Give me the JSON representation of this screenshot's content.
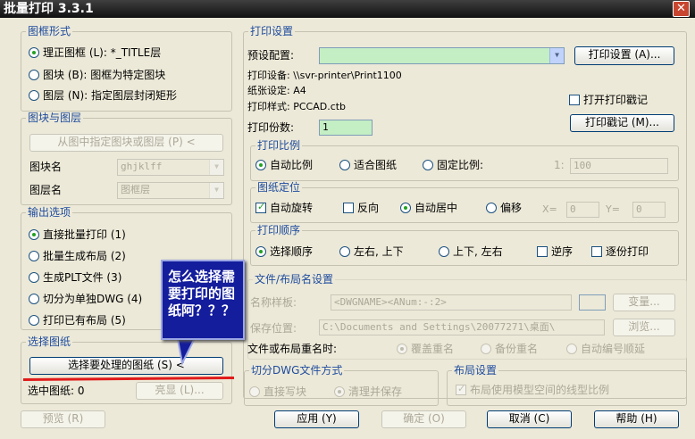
{
  "window": {
    "title": "批量打印 3.3.1",
    "close_glyph": "✕"
  },
  "frame_form": {
    "title": "图框形式",
    "options": [
      {
        "label": "理正图框 (L): *_TITLE层",
        "selected": true
      },
      {
        "label": "图块 (B): 图框为特定图块",
        "selected": false
      },
      {
        "label": "图层 (N): 指定图层封闭矩形",
        "selected": false
      }
    ]
  },
  "block_layer": {
    "title": "图块与图层",
    "pick_button": "从图中指定图块或图层 (P) <",
    "block_name_label": "图块名",
    "block_name_value": "ghjklff",
    "layer_name_label": "图层名",
    "layer_name_value": "图框层"
  },
  "output": {
    "title": "输出选项",
    "options": [
      {
        "label": "直接批量打印 (1)",
        "selected": true
      },
      {
        "label": "批量生成布局 (2)",
        "selected": false
      },
      {
        "label": "生成PLT文件 (3)",
        "selected": false
      },
      {
        "label": "切分为单独DWG (4)",
        "selected": false
      },
      {
        "label": "打印已有布局 (5)",
        "selected": false
      }
    ]
  },
  "select_drawings": {
    "title": "选择图纸",
    "select_button": "选择要处理的图纸 (S) <",
    "selected_count_label": "选中图纸: 0",
    "highlight_button": "亮显 (L)..."
  },
  "print_settings": {
    "title": "打印设置",
    "preset_label": "预设配置:",
    "preset_value": "",
    "settings_button": "打印设置 (A)...",
    "device": "打印设备: \\\\svr-printer\\Print1100",
    "paper": "纸张设定: A4",
    "style": "打印样式: PCCAD.ctb",
    "open_stamp_label": "打开打印戳记",
    "open_stamp_checked": false,
    "stamp_button": "打印戳记 (M)...",
    "copies_label": "打印份数:",
    "copies_value": "1"
  },
  "scale": {
    "title": "打印比例",
    "options": [
      {
        "label": "自动比例",
        "selected": true
      },
      {
        "label": "适合图纸",
        "selected": false
      },
      {
        "label": "固定比例:",
        "selected": false
      }
    ],
    "ratio_label": "1:",
    "ratio_value": "100"
  },
  "position": {
    "title": "图纸定位",
    "auto_rotate": "自动旋转",
    "auto_rotate_checked": true,
    "reverse": "反向",
    "reverse_checked": false,
    "center": "自动居中",
    "offset": "偏移",
    "x_label": "X=",
    "x_value": "0",
    "y_label": "Y=",
    "y_value": "0"
  },
  "order": {
    "title": "打印顺序",
    "options": [
      {
        "label": "选择顺序",
        "selected": true
      },
      {
        "label": "左右, 上下",
        "selected": false
      },
      {
        "label": "上下, 左右",
        "selected": false
      }
    ],
    "reverse_label": "逆序",
    "reverse_checked": false,
    "per_copy_label": "逐份打印",
    "per_copy_checked": false
  },
  "file_name": {
    "title": "文件/布局名设置",
    "template_label": "名称样板:",
    "template_value": "<DWGNAME><ANum:-:2>",
    "variable_button": "变量...",
    "save_label": "保存位置:",
    "save_value": "C:\\Documents and Settings\\20077271\\桌面\\",
    "browse_button": "浏览...",
    "rename_label": "文件或布局重名时:",
    "rename_options": [
      {
        "label": "覆盖重名",
        "selected": true
      },
      {
        "label": "备份重名",
        "selected": false
      },
      {
        "label": "自动编号顺延",
        "selected": false
      }
    ]
  },
  "split": {
    "title": "切分DWG文件方式",
    "options": [
      {
        "label": "直接写块",
        "selected": false
      },
      {
        "label": "清理并保存",
        "selected": true
      }
    ]
  },
  "layout": {
    "title": "布局设置",
    "model_linetype_label": "布局使用模型空间的线型比例",
    "checked": true
  },
  "bottom": {
    "preview": "预览 (R)",
    "apply": "应用 (Y)",
    "ok": "确定 (O)",
    "cancel": "取消 (C)",
    "help": "帮助 (H)"
  },
  "annotation": {
    "text": "怎么选择需\n要打印的图\n纸阿？？？"
  },
  "colors": {
    "title_bar": "#111111",
    "group_title": "#1e4b9e",
    "preset_field": "#c4eec4",
    "copies_field": "#c4eec4",
    "callout": "#141d9c",
    "underline": "#e01a1a"
  }
}
